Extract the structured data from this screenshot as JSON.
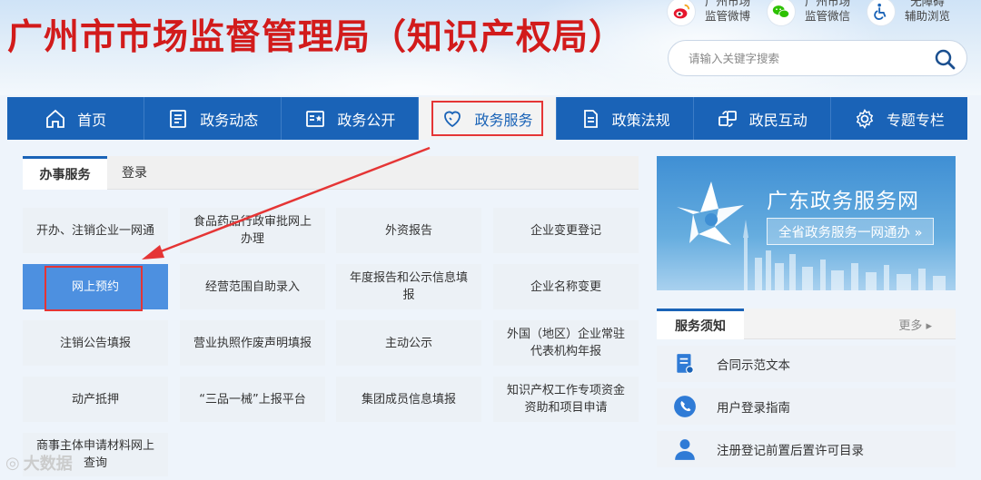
{
  "header": {
    "site_title": "广州市市场监督管理局（知识产权局）",
    "links": [
      {
        "label": "广州市场\n监管微博",
        "icon": "weibo-icon",
        "color": "#e6162d"
      },
      {
        "label": "广州市场\n监管微信",
        "icon": "wechat-icon",
        "color": "#2dc100"
      },
      {
        "label": "无障碍\n辅助浏览",
        "icon": "accessibility-icon",
        "color": "#1a63b7"
      }
    ],
    "search": {
      "placeholder": "请输入关键字搜索",
      "value": ""
    }
  },
  "nav": {
    "items": [
      {
        "label": "首页",
        "icon": "home-icon"
      },
      {
        "label": "政务动态",
        "icon": "news-icon"
      },
      {
        "label": "政务公开",
        "icon": "open-icon"
      },
      {
        "label": "政务服务",
        "icon": "heart-icon",
        "active": true
      },
      {
        "label": "政策法规",
        "icon": "document-icon"
      },
      {
        "label": "政民互动",
        "icon": "interaction-icon"
      },
      {
        "label": "专题专栏",
        "icon": "gear-icon"
      }
    ]
  },
  "services": {
    "tabs": [
      "办事服务",
      "登录"
    ],
    "items": [
      "开办、注销企业一网通",
      "食品药品行政审批网上办理",
      "外资报告",
      "企业变更登记",
      "网上预约",
      "经营范围自助录入",
      "年度报告和公示信息填报",
      "企业名称变更",
      "注销公告填报",
      "营业执照作废声明填报",
      "主动公示",
      "外国（地区）企业常驻代表机构年报",
      "动产抵押",
      "“三品一械”上报平台",
      "集团成员信息填报",
      "知识产权工作专项资金资助和项目申请",
      "商事主体申请材料网上查询"
    ],
    "active_index": 4
  },
  "banner": {
    "title": "广东政务服务网",
    "subtitle": "全省政务服务一网通办 »"
  },
  "notice": {
    "title": "服务须知",
    "more": "更多",
    "items": [
      {
        "label": "合同示范文本",
        "icon": "contract-icon"
      },
      {
        "label": "用户登录指南",
        "icon": "phone-icon"
      },
      {
        "label": "注册登记前置后置许可目录",
        "icon": "user-icon"
      }
    ]
  },
  "watermark": "大数据",
  "colors": {
    "brand_blue": "#1a63b7",
    "title_red": "#d21b1b",
    "highlight_red": "#e53535",
    "active_tile": "#4d90e0"
  }
}
